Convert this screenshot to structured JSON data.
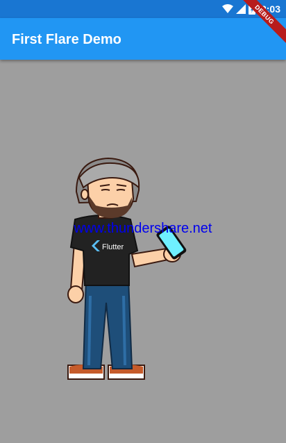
{
  "status_bar": {
    "time": "12:03",
    "icons": [
      "wifi-icon",
      "signal-icon",
      "battery-icon"
    ]
  },
  "app_bar": {
    "title": "First Flare Demo"
  },
  "debug_banner": {
    "label": "DEBUG"
  },
  "content": {
    "character_shirt_label": "Flutter",
    "watermark": "www.thundershare.net"
  },
  "colors": {
    "status_bar": "#1976d2",
    "app_bar": "#2196f3",
    "background": "#9e9e9e",
    "debug_banner": "#b71c1c",
    "phone_screen": "#6ff0ff"
  }
}
